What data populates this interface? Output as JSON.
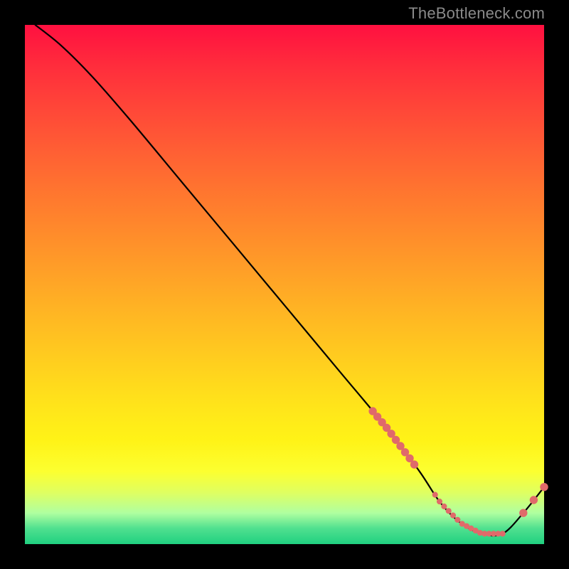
{
  "watermark": "TheBottleneck.com",
  "chart_data": {
    "type": "line",
    "title": "",
    "xlabel": "",
    "ylabel": "",
    "xlim": [
      0,
      100
    ],
    "ylim": [
      0,
      100
    ],
    "grid": false,
    "curve": {
      "x": [
        2,
        7,
        13,
        20,
        30,
        40,
        50,
        60,
        70,
        76,
        80,
        84,
        88,
        92,
        96,
        100
      ],
      "y": [
        100,
        96,
        90,
        82,
        70,
        58,
        46,
        34,
        22,
        14,
        8,
        4,
        2,
        2,
        6,
        11
      ]
    },
    "marker_clusters": [
      {
        "x_range": [
          67,
          75
        ],
        "y_range": [
          11,
          22
        ],
        "count": 10
      },
      {
        "x_range": [
          79,
          92
        ],
        "y_range": [
          2,
          4
        ],
        "count": 16
      },
      {
        "x_range": [
          96,
          100
        ],
        "y_range": [
          6,
          11
        ],
        "count": 3
      }
    ],
    "colors": {
      "curve": "#000000",
      "markers": "#e06a6a",
      "background_top": "#ff1040",
      "background_bottom": "#20d080",
      "frame": "#000000",
      "watermark": "#8a8a8a"
    }
  }
}
